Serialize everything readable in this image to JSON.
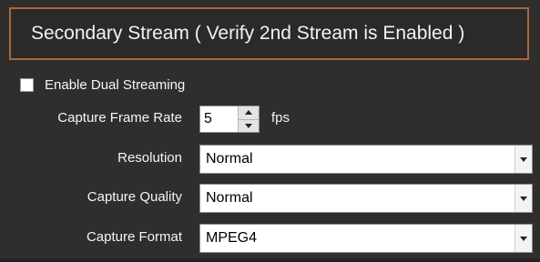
{
  "section": {
    "title": "Secondary Stream ( Verify 2nd Stream is Enabled )"
  },
  "dual_streaming": {
    "label": "Enable Dual Streaming",
    "checked": false
  },
  "frame_rate": {
    "label": "Capture Frame Rate",
    "value": "5",
    "unit": "fps"
  },
  "resolution": {
    "label": "Resolution",
    "selected": "Normal"
  },
  "quality": {
    "label": "Capture Quality",
    "selected": "Normal"
  },
  "format": {
    "label": "Capture Format",
    "selected": "MPEG4"
  },
  "colors": {
    "background": "#2f2e2c",
    "header_border": "#a8663a",
    "text": "#f5f5f5",
    "field_bg": "#ffffff"
  },
  "icons": {
    "spinner_up": "triangle-up-icon",
    "spinner_down": "triangle-down-icon",
    "dropdown": "dropdown-arrow-icon"
  }
}
